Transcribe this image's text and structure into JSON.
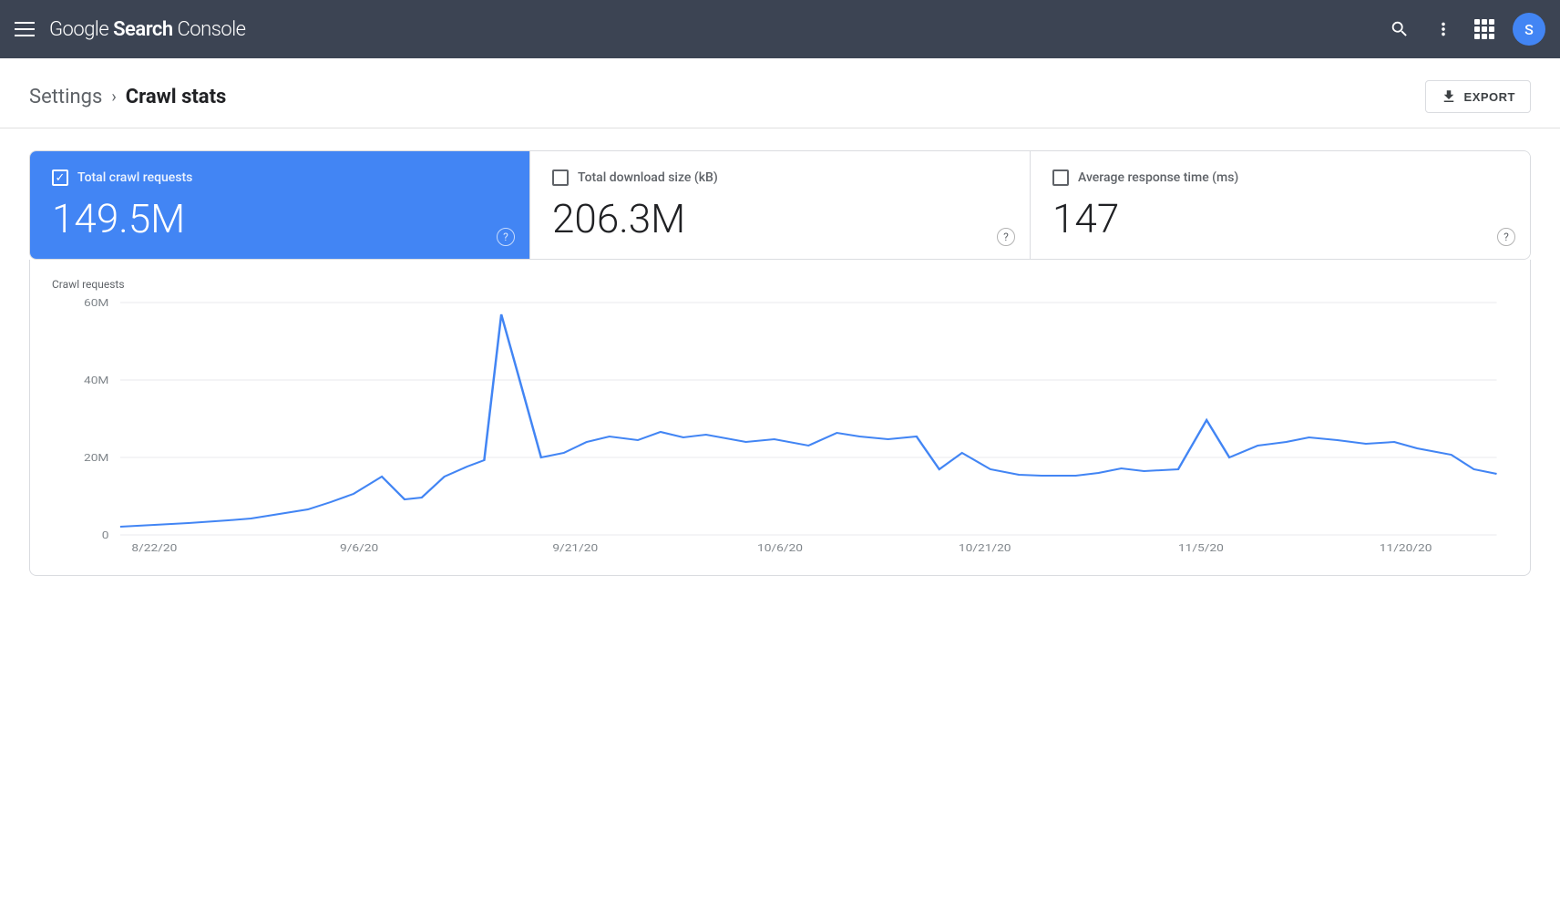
{
  "header": {
    "title": "Google Search Console",
    "title_google": "Google ",
    "title_search": "Search",
    "title_console": " Console",
    "avatar_letter": "S"
  },
  "breadcrumb": {
    "settings_label": "Settings",
    "separator": ">",
    "current_label": "Crawl stats"
  },
  "toolbar": {
    "export_label": "EXPORT"
  },
  "metrics": [
    {
      "id": "total-crawl-requests",
      "label": "Total crawl requests",
      "value": "149.5M",
      "active": true,
      "checked": true
    },
    {
      "id": "total-download-size",
      "label": "Total download size (kB)",
      "value": "206.3M",
      "active": false,
      "checked": false
    },
    {
      "id": "avg-response-time",
      "label": "Average response time (ms)",
      "value": "147",
      "active": false,
      "checked": false
    }
  ],
  "chart": {
    "y_axis_label": "Crawl requests",
    "y_labels": [
      "60M",
      "40M",
      "20M",
      "0"
    ],
    "x_labels": [
      "8/22/20",
      "9/6/20",
      "9/21/20",
      "10/6/20",
      "10/21/20",
      "11/5/20",
      "11/20/20"
    ],
    "accent_color": "#4285f4"
  }
}
